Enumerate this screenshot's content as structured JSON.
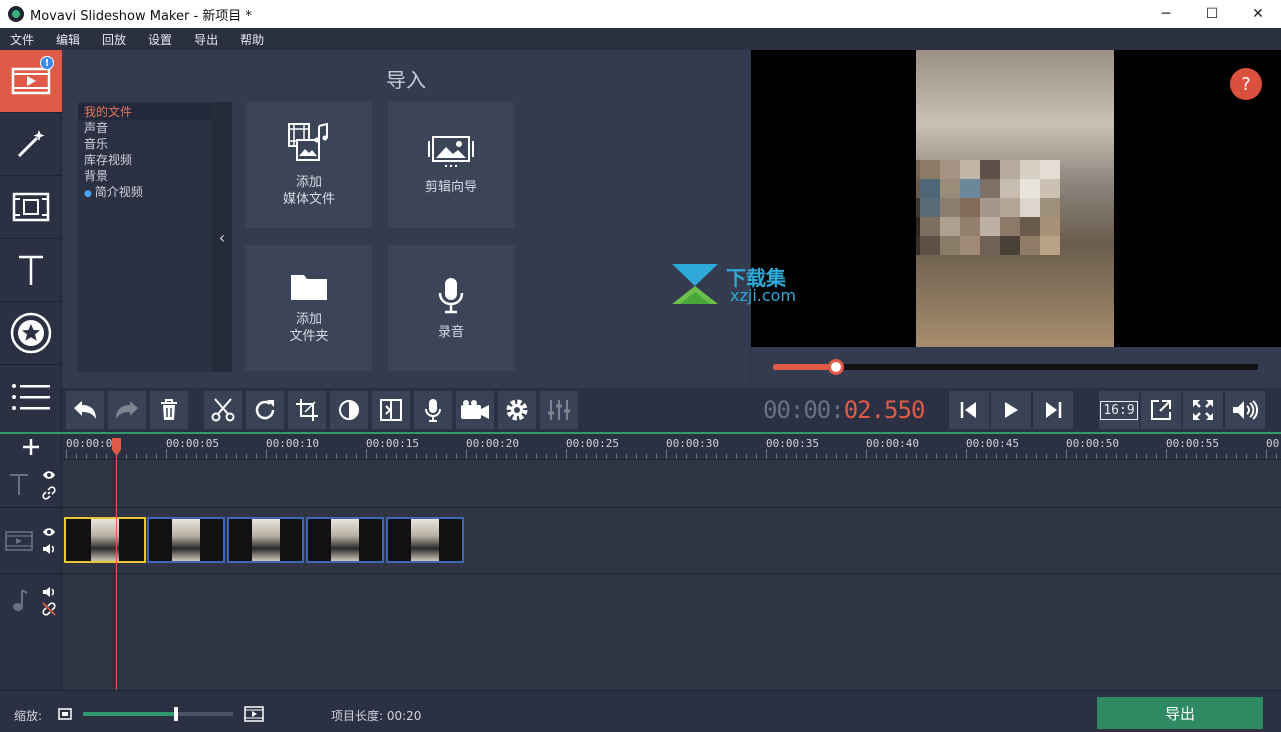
{
  "window": {
    "title": "Movavi Slideshow Maker - 新项目 *",
    "minimize": "─",
    "maximize": "☐",
    "close": "✕"
  },
  "menu": [
    "文件",
    "编辑",
    "回放",
    "设置",
    "导出",
    "帮助"
  ],
  "sidebar": {
    "badge": "!",
    "items": [
      "import-icon",
      "magic-wand-icon",
      "transitions-icon",
      "text-icon",
      "sticker-icon",
      "list-icon"
    ]
  },
  "import": {
    "title": "导入",
    "categories": [
      "我的文件",
      "声音",
      "音乐",
      "库存视频",
      "背景",
      "简介视频"
    ],
    "selected_category": "我的文件",
    "collapse_glyph": "‹",
    "tiles": [
      {
        "label": "添加\n媒体文件",
        "icon": "add-media-icon"
      },
      {
        "label": "剪辑向导",
        "icon": "montage-wizard-icon"
      },
      {
        "label": "添加\n文件夹",
        "icon": "folder-icon"
      },
      {
        "label": "录音",
        "icon": "microphone-icon"
      }
    ]
  },
  "preview": {
    "help": "?",
    "seek_fraction": 0.13
  },
  "watermark": {
    "text": "下载集",
    "sub": "xzji.com"
  },
  "toolbar": {
    "items": [
      "undo-icon",
      "redo-icon",
      "delete-icon",
      "cut-icon",
      "rotate-icon",
      "crop-icon",
      "color-adjust-icon",
      "transition-wizard-icon",
      "record-audio-icon",
      "capture-video-icon",
      "settings-icon",
      "equalizer-icon"
    ]
  },
  "player": {
    "timecode_dim": "00:00:",
    "timecode_hl": "02.550",
    "aspect_ratio": "16:9"
  },
  "timeline": {
    "ticks": [
      "00:00:0",
      "00:00:05",
      "00:00:10",
      "00:00:15",
      "00:00:20",
      "00:00:25",
      "00:00:30",
      "00:00:35",
      "00:00:40",
      "00:00:45",
      "00:00:50",
      "00:00:55",
      "00"
    ],
    "clips": 5
  },
  "status": {
    "zoom_label": "缩放:",
    "zoom_fraction": 0.62,
    "project_length": "项目长度: 00:20",
    "export_label": "导出"
  },
  "colors": {
    "accent": "#e05a48",
    "export": "#2f8a63",
    "selection": "#e6c530",
    "clip_border": "#4064b6"
  }
}
